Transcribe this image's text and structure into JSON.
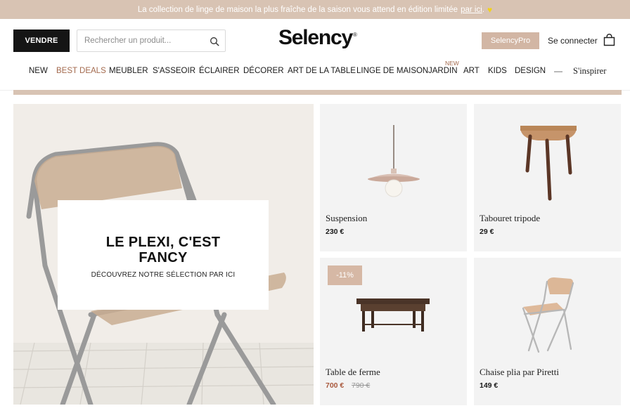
{
  "promo": {
    "text": "La collection de linge de maison la plus fraîche de la saison vous attend en édition limitée",
    "link": "par ici",
    "after_link": "."
  },
  "header": {
    "sell_button": "VENDRE",
    "search_placeholder": "Rechercher un produit...",
    "logo": "Selency",
    "logo_mark": "®",
    "pro_button": "SelencyPro",
    "login": "Se connecter"
  },
  "nav": {
    "items": [
      "NEW",
      "BEST DEALS",
      "MEUBLER",
      "S'ASSEOIR",
      "ÉCLAIRER",
      "DÉCORER",
      "ART DE LA TABLE",
      "LINGE DE MAISON",
      "JARDIN",
      "ART",
      "KIDS",
      "DESIGN"
    ],
    "jardin_badge": "NEW",
    "separator": "—",
    "inspire": "S'inspirer"
  },
  "hero": {
    "title": "LE PLEXI, C'EST FANCY",
    "subtitle": "DÉCOUVREZ NOTRE SÉLECTION PAR ICI"
  },
  "products": [
    {
      "name": "Suspension",
      "price": "230 €"
    },
    {
      "name": "Tabouret tripode",
      "price": "29 €"
    },
    {
      "name": "Table de ferme",
      "price": "700 €",
      "old_price": "790 €",
      "badge": "-11%"
    },
    {
      "name": "Chaise plia par Piretti",
      "price": "149 €"
    }
  ],
  "colors": {
    "accent": "#d8c3b3",
    "sale": "#a9593d",
    "dark": "#151515"
  }
}
